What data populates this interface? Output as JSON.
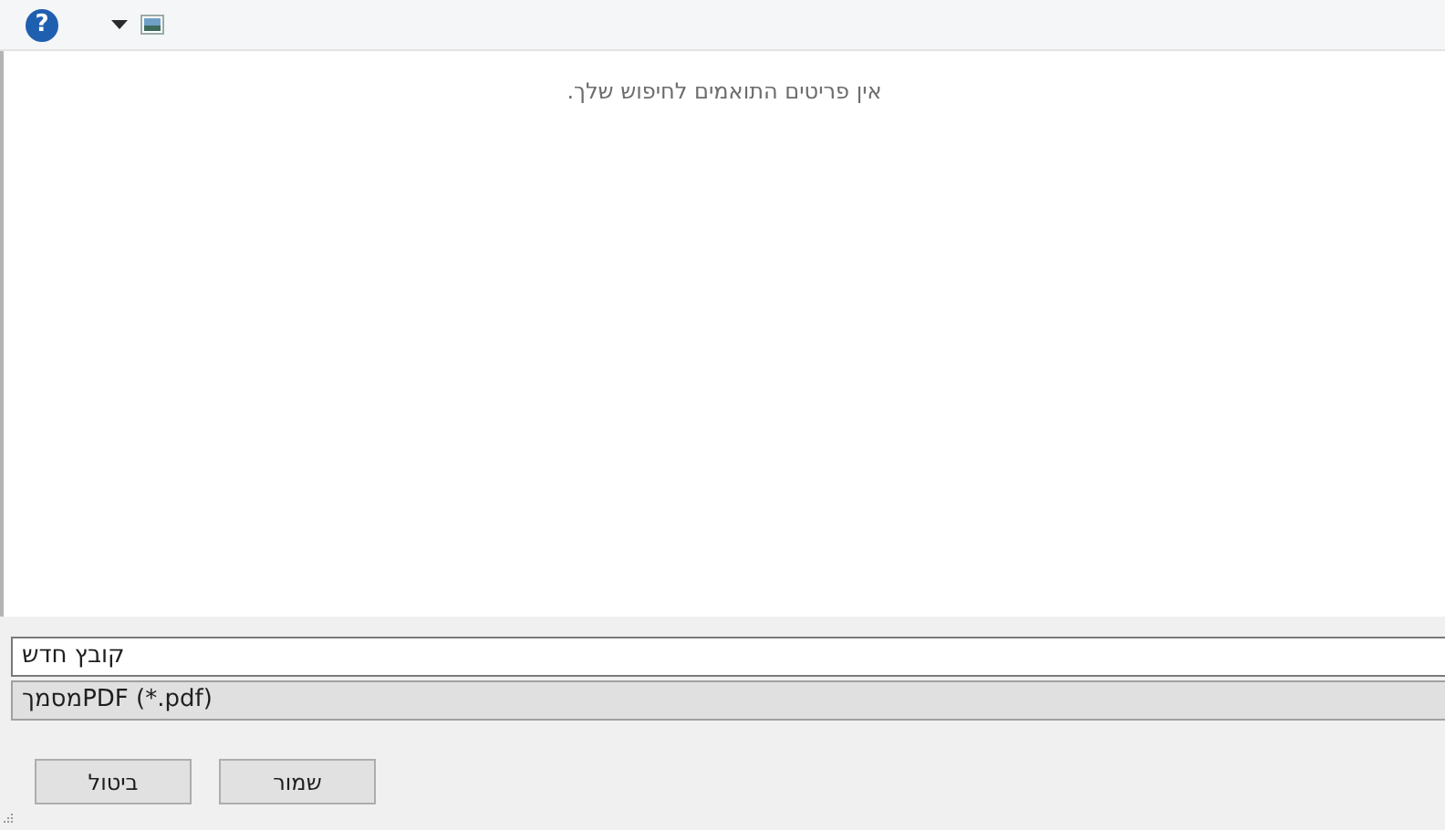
{
  "toolbar": {
    "help": "?"
  },
  "results": {
    "message": "אין פריטים התואמים לחיפוש שלך."
  },
  "file_name": {
    "value": "קובץ חדש"
  },
  "file_type": {
    "value": "מסמךPDF (*.pdf)"
  },
  "buttons": [
    {
      "label": "שמור"
    },
    {
      "label": "ביטול"
    }
  ]
}
